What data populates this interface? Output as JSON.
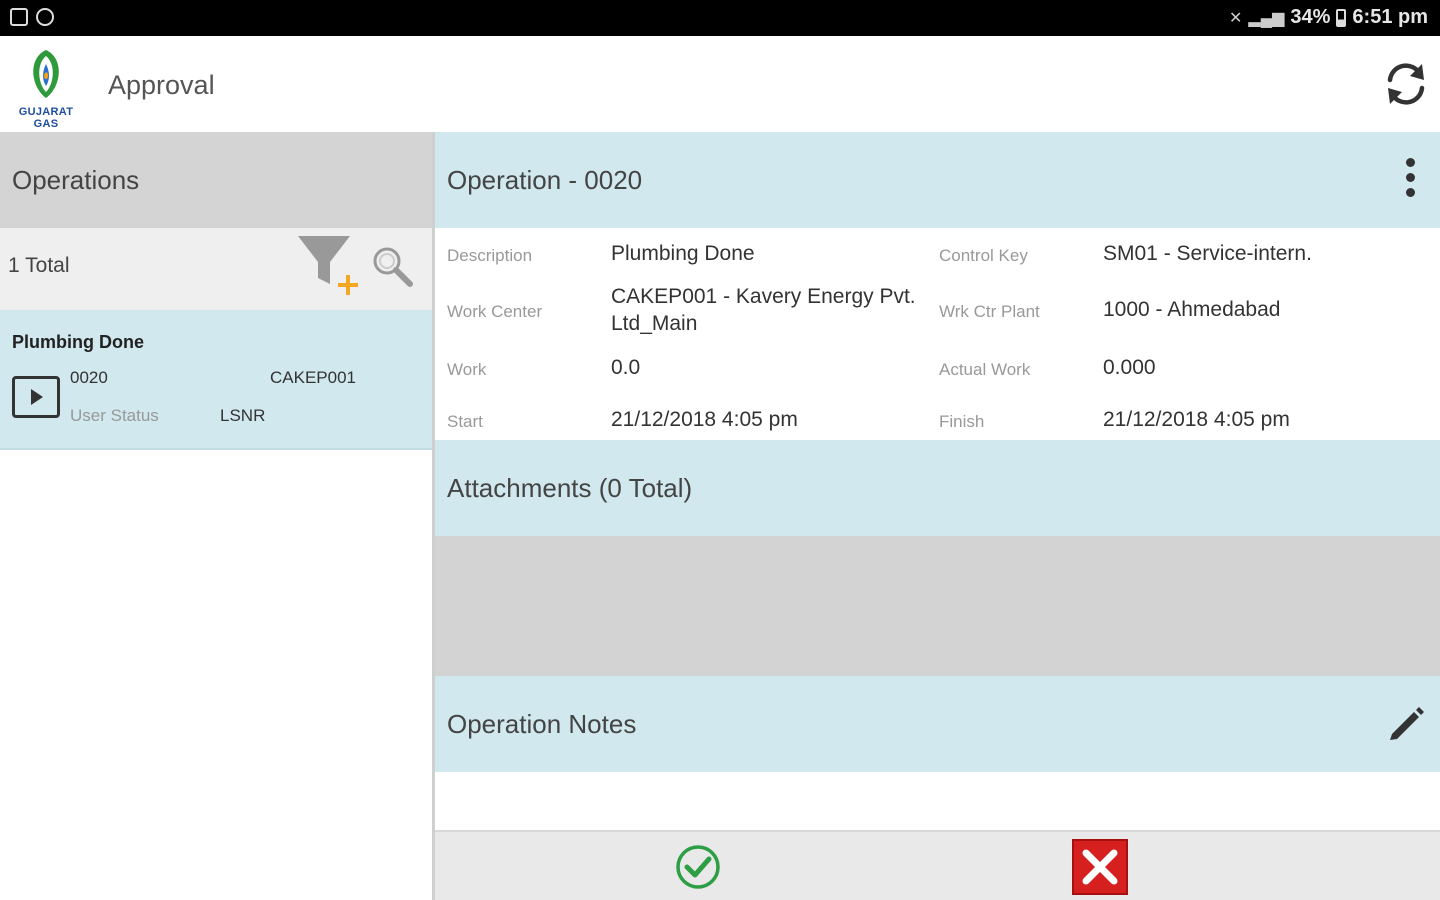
{
  "status_bar": {
    "battery": "34%",
    "time": "6:51 pm"
  },
  "app": {
    "logo_text": "GUJARAT GAS",
    "title": "Approval"
  },
  "operations_panel": {
    "header": "Operations",
    "total": "1 Total",
    "items": [
      {
        "title": "Plumbing Done",
        "number": "0020",
        "work_center": "CAKEP001",
        "user_status_label": "User Status",
        "user_status": "LSNR"
      }
    ]
  },
  "operation_detail": {
    "header": "Operation - 0020",
    "description_label": "Description",
    "description": "Plumbing Done",
    "control_key_label": "Control Key",
    "control_key": "SM01 - Service-intern.",
    "work_center_label": "Work Center",
    "work_center": "CAKEP001 - Kavery Energy Pvt. Ltd_Main",
    "wrk_ctr_plant_label": "Wrk Ctr Plant",
    "wrk_ctr_plant": "1000 - Ahmedabad",
    "work_label": "Work",
    "work": "0.0",
    "actual_work_label": "Actual Work",
    "actual_work": "0.000",
    "start_label": "Start",
    "start": "21/12/2018 4:05 pm",
    "finish_label": "Finish",
    "finish": "21/12/2018 4:05 pm"
  },
  "attachments": {
    "header": "Attachments (0 Total)"
  },
  "notes": {
    "header": "Operation Notes"
  },
  "colors": {
    "accent_panel": "#d1e8ee",
    "approve": "#2e9e44",
    "reject": "#d61f1f",
    "filter_plus": "#f5a623"
  },
  "icons": [
    "refresh-icon",
    "filter-add-icon",
    "search-icon",
    "play-icon",
    "more-vert-icon",
    "edit-icon",
    "check-circle-icon",
    "close-icon"
  ]
}
